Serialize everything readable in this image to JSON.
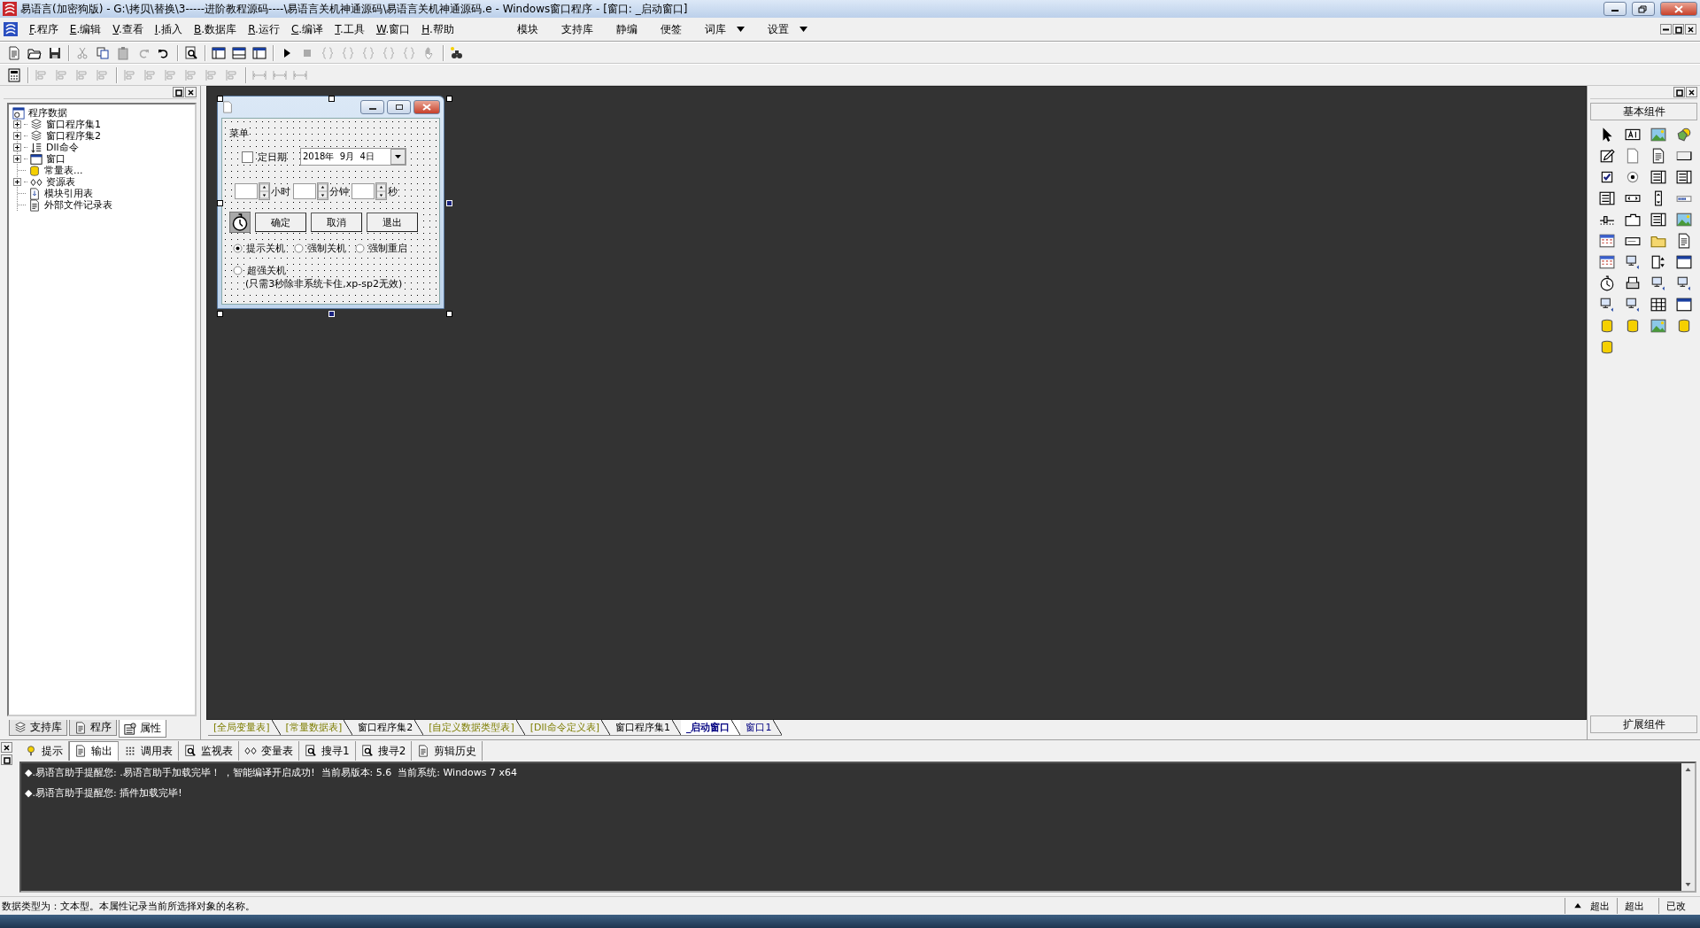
{
  "window": {
    "title": "易语言(加密狗版) - G:\\拷贝\\替换\\3-----进阶教程源码----\\易语言关机神通源码\\易语言关机神通源码.e - Windows窗口程序 - [窗口: _启动窗口]"
  },
  "menu": {
    "items": [
      "F.程序",
      "E.编辑",
      "V.查看",
      "I.插入",
      "B.数据库",
      "R.运行",
      "C.编译",
      "T.工具",
      "W.窗口",
      "H.帮助"
    ],
    "extras": [
      {
        "label": "模块",
        "dropdown": false
      },
      {
        "label": "支持库",
        "dropdown": false
      },
      {
        "label": "静编",
        "dropdown": false
      },
      {
        "label": "便签",
        "dropdown": false
      },
      {
        "label": "词库",
        "dropdown": true
      },
      {
        "label": "设置",
        "dropdown": true
      }
    ]
  },
  "tree": {
    "label": "程序数据",
    "children": [
      {
        "label": "窗口程序集1",
        "kind": "module",
        "expanded": false
      },
      {
        "label": "窗口程序集2",
        "kind": "module",
        "expanded": false
      },
      {
        "label": "Dll命令",
        "kind": "dll",
        "expanded": false
      },
      {
        "label": "窗口",
        "kind": "window",
        "expanded": false
      },
      {
        "label": "常量表...",
        "kind": "constants"
      },
      {
        "label": "资源表",
        "kind": "resources",
        "expanded": false
      },
      {
        "label": "模块引用表",
        "kind": "module_refs"
      },
      {
        "label": "外部文件记录表",
        "kind": "files"
      }
    ]
  },
  "left_tabs": [
    {
      "label": "支持库",
      "kind": "library",
      "selected": false
    },
    {
      "label": "程序",
      "kind": "program",
      "selected": false
    },
    {
      "label": "属性",
      "kind": "properties",
      "selected": true
    }
  ],
  "designer": {
    "menu": "菜单",
    "date_checkbox": {
      "label": "定日期",
      "checked": false
    },
    "date": "2018年  9月  4日",
    "spinners": [
      {
        "unit": "小时"
      },
      {
        "unit": "分钟"
      },
      {
        "unit": "秒"
      }
    ],
    "buttons": [
      "确定",
      "取消",
      "退出"
    ],
    "radios": [
      {
        "label": "提示关机",
        "selected": true
      },
      {
        "label": "强制关机",
        "selected": false
      },
      {
        "label": "强制重启",
        "selected": false
      },
      {
        "label": "超强关机",
        "note": "(只需3秒除非系统卡住,xp-sp2无效)",
        "selected": false
      }
    ]
  },
  "doc_tabs": [
    {
      "label": "[全局变量表]",
      "kind": "table",
      "selected": false
    },
    {
      "label": "[常量数据表]",
      "kind": "table",
      "selected": false
    },
    {
      "label": "窗口程序集2",
      "kind": "code",
      "selected": false
    },
    {
      "label": "[自定义数据类型表]",
      "kind": "table",
      "selected": false
    },
    {
      "label": "[Dll命令定义表]",
      "kind": "table",
      "selected": false
    },
    {
      "label": "窗口程序集1",
      "kind": "code",
      "selected": false
    },
    {
      "label": "_启动窗口",
      "kind": "window",
      "selected": true
    },
    {
      "label": "窗口1",
      "kind": "window",
      "selected": false
    }
  ],
  "palette": {
    "title": "基本组件",
    "footer": "扩展组件"
  },
  "output": {
    "tabs": [
      {
        "label": "提示",
        "kind": "hint",
        "selected": false
      },
      {
        "label": "输出",
        "kind": "output",
        "selected": true
      },
      {
        "label": "调用表",
        "kind": "calls",
        "selected": false
      },
      {
        "label": "监视表",
        "kind": "watch",
        "selected": false
      },
      {
        "label": "变量表",
        "kind": "variables",
        "selected": false
      },
      {
        "label": "搜寻1",
        "kind": "search",
        "selected": false
      },
      {
        "label": "搜寻2",
        "kind": "search",
        "selected": false
      },
      {
        "label": "剪辑历史",
        "kind": "clipboard",
        "selected": false
      }
    ],
    "lines": [
      "◆.易语言助手提醒您: .易语言助手加载完毕！ ，智能编译开启成功!  当前易版本: 5.6  当前系统: Windows 7 x64",
      "◆.易语言助手提醒您: 插件加载完毕!"
    ]
  },
  "status": {
    "text": "数据类型为：文本型。本属性记录当前所选择对象的名称。",
    "fields": [
      "超出",
      "超出",
      "已改"
    ]
  }
}
